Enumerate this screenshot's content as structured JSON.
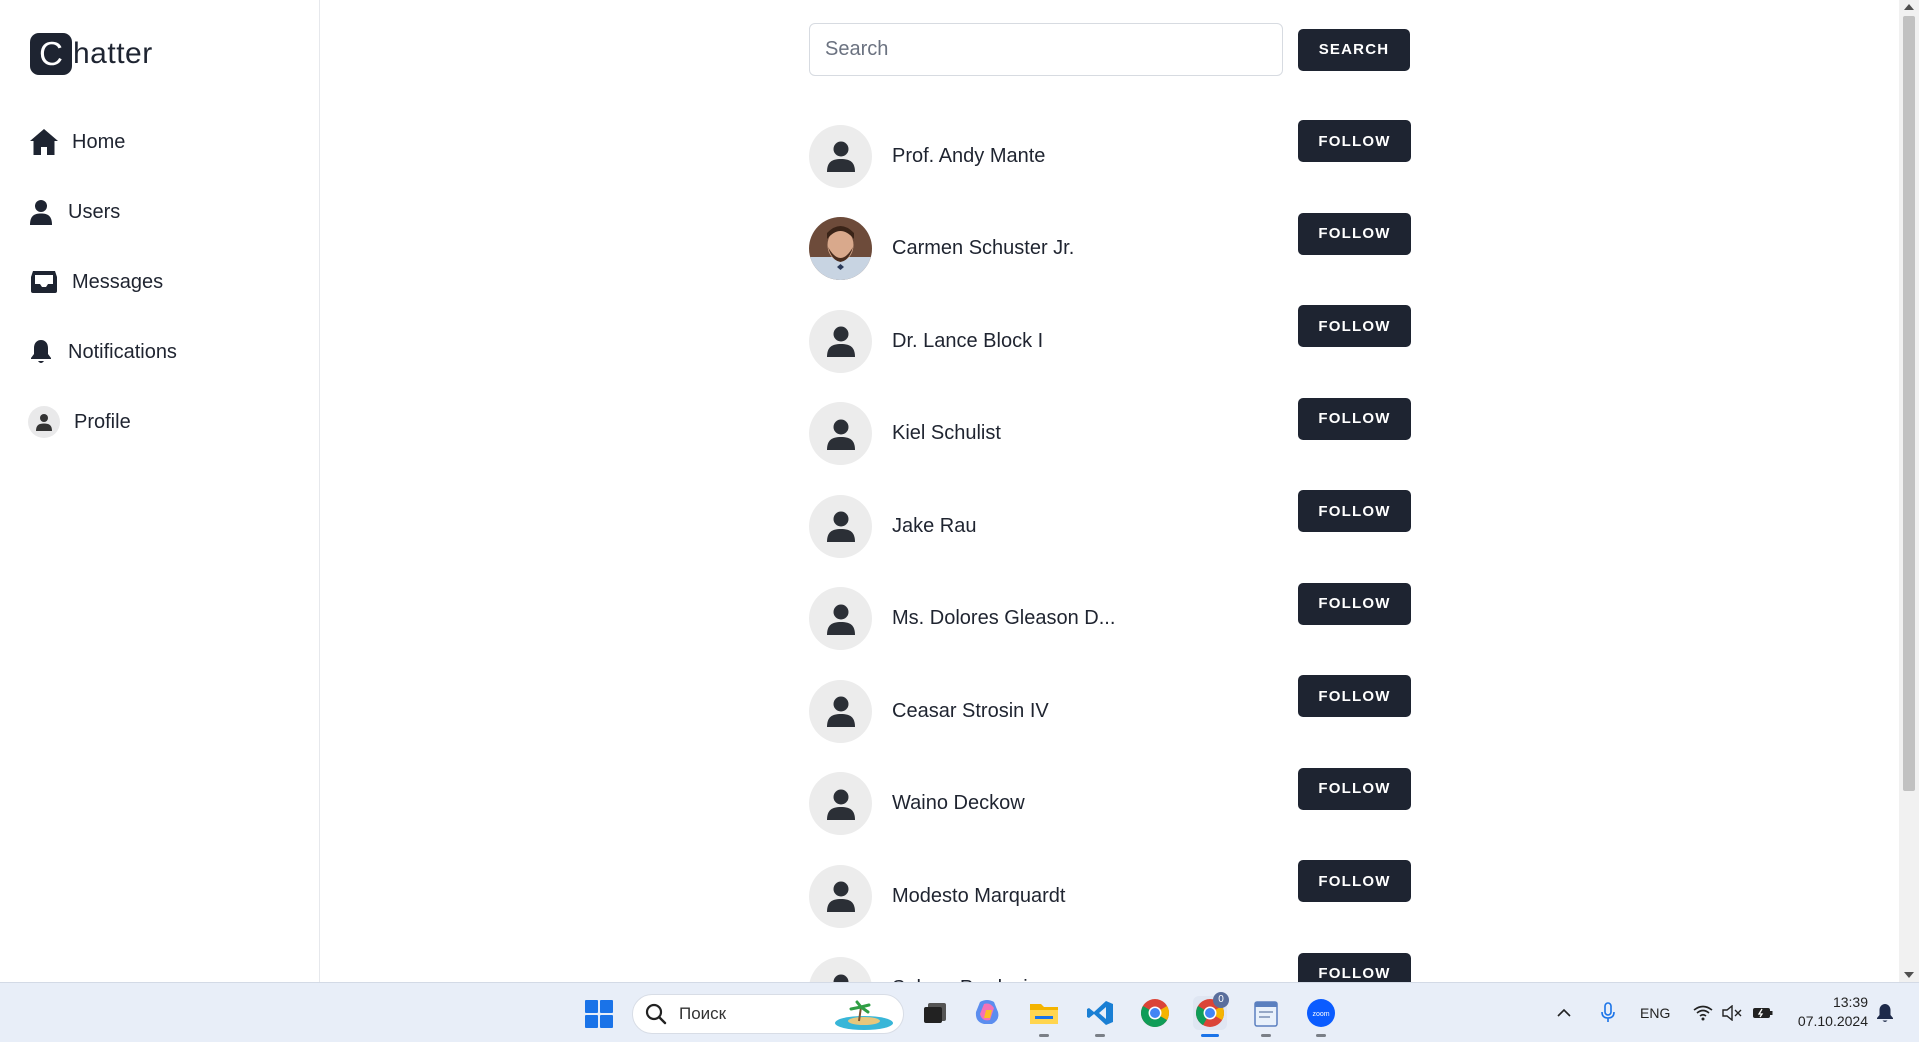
{
  "app": {
    "logo_letter": "C",
    "logo_rest": "hatter"
  },
  "sidebar": {
    "items": [
      {
        "label": "Home",
        "icon": "home-icon"
      },
      {
        "label": "Users",
        "icon": "user-icon"
      },
      {
        "label": "Messages",
        "icon": "inbox-icon"
      },
      {
        "label": "Notifications",
        "icon": "bell-icon"
      },
      {
        "label": "Profile",
        "icon": "avatar-icon"
      }
    ]
  },
  "search": {
    "placeholder": "Search",
    "value": "",
    "button_label": "SEARCH"
  },
  "users": [
    {
      "name": "Prof. Andy Mante",
      "follow_label": "FOLLOW",
      "has_photo": false
    },
    {
      "name": "Carmen Schuster Jr.",
      "follow_label": "FOLLOW",
      "has_photo": true
    },
    {
      "name": "Dr. Lance Block I",
      "follow_label": "FOLLOW",
      "has_photo": false
    },
    {
      "name": "Kiel Schulist",
      "follow_label": "FOLLOW",
      "has_photo": false
    },
    {
      "name": "Jake Rau",
      "follow_label": "FOLLOW",
      "has_photo": false
    },
    {
      "name": "Ms. Dolores Gleason D...",
      "follow_label": "FOLLOW",
      "has_photo": false
    },
    {
      "name": "Ceasar Strosin IV",
      "follow_label": "FOLLOW",
      "has_photo": false
    },
    {
      "name": "Waino Deckow",
      "follow_label": "FOLLOW",
      "has_photo": false
    },
    {
      "name": "Modesto Marquardt",
      "follow_label": "FOLLOW",
      "has_photo": false
    },
    {
      "name": "Selena Predovic",
      "follow_label": "FOLLOW",
      "has_photo": false
    }
  ],
  "colors": {
    "primary": "#1e2431",
    "avatar_bg": "#ececec",
    "accent_taskbar": "#1a73e8"
  },
  "taskbar": {
    "search_placeholder": "Поиск",
    "language": "ENG",
    "time": "13:39",
    "date": "07.10.2024",
    "chrome_badge": "0"
  }
}
